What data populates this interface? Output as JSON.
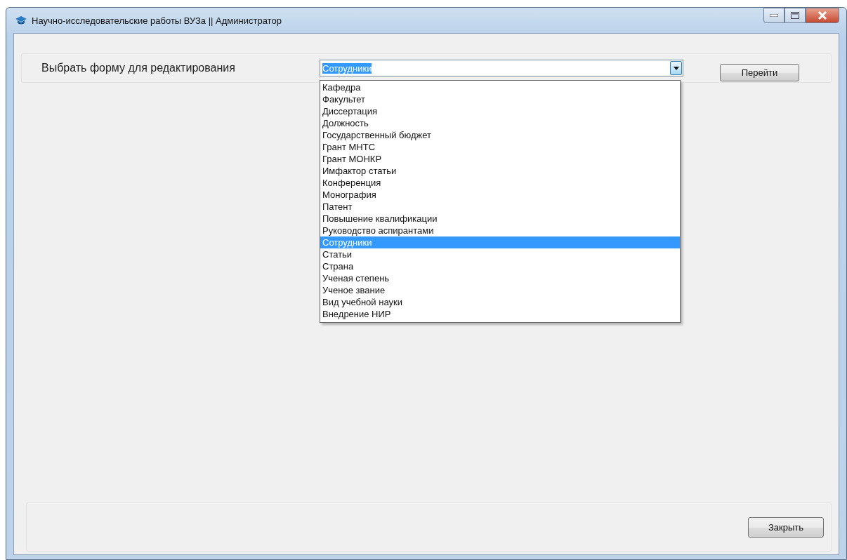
{
  "window": {
    "title": "Научно-исследовательские работы ВУЗа || Администратор"
  },
  "form_selector": {
    "label": "Выбрать форму для редактирования",
    "value": "Сотрудники",
    "expanded": true,
    "button": "Перейти",
    "items": [
      {
        "label": "Кафедра",
        "selected": false
      },
      {
        "label": "Факультет",
        "selected": false
      },
      {
        "label": "Диссертация",
        "selected": false
      },
      {
        "label": "Должность",
        "selected": false
      },
      {
        "label": "Государственный бюджет",
        "selected": false
      },
      {
        "label": "Грант МНТС",
        "selected": false
      },
      {
        "label": "Грант МОНКР",
        "selected": false
      },
      {
        "label": "Имфактор статьи",
        "selected": false
      },
      {
        "label": "Конференция",
        "selected": false
      },
      {
        "label": "Монография",
        "selected": false
      },
      {
        "label": "Патент",
        "selected": false
      },
      {
        "label": "Повышение квалификации",
        "selected": false
      },
      {
        "label": "Руководство аспирантами",
        "selected": false
      },
      {
        "label": "Сотрудники",
        "selected": true
      },
      {
        "label": "Статьи",
        "selected": false
      },
      {
        "label": "Страна",
        "selected": false
      },
      {
        "label": "Ученая степень",
        "selected": false
      },
      {
        "label": "Ученое звание",
        "selected": false
      },
      {
        "label": "Вид учебной науки",
        "selected": false
      },
      {
        "label": "Внедрение НИР",
        "selected": false
      }
    ]
  },
  "footer": {
    "button": "Закрыть"
  }
}
